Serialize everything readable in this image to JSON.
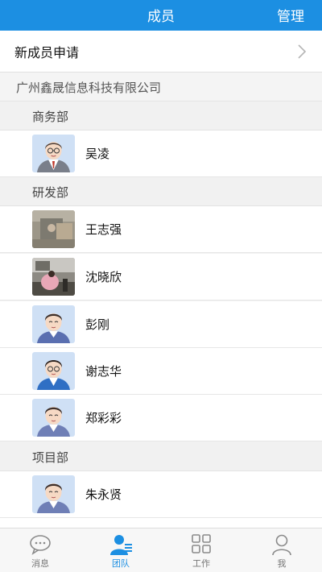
{
  "header": {
    "title": "成员",
    "manage_label": "管理"
  },
  "new_member": {
    "label": "新成员申请"
  },
  "company": {
    "name": "广州鑫晟信息科技有限公司"
  },
  "departments": [
    {
      "name": "商务部",
      "members": [
        {
          "name": "吴凌"
        }
      ]
    },
    {
      "name": "研发部",
      "members": [
        {
          "name": "王志强"
        },
        {
          "name": "沈晓欣"
        },
        {
          "name": "彭刚"
        },
        {
          "name": "谢志华"
        },
        {
          "name": "郑彩彩"
        }
      ]
    },
    {
      "name": "项目部",
      "members": [
        {
          "name": "朱永贤"
        }
      ]
    }
  ],
  "tabs": [
    {
      "label": "消息",
      "icon": "chat-bubble-icon"
    },
    {
      "label": "团队",
      "icon": "team-icon",
      "active": true
    },
    {
      "label": "工作",
      "icon": "grid-icon"
    },
    {
      "label": "我",
      "icon": "person-icon"
    }
  ],
  "colors": {
    "accent": "#1c8fe2",
    "background": "#f2f2f2"
  }
}
